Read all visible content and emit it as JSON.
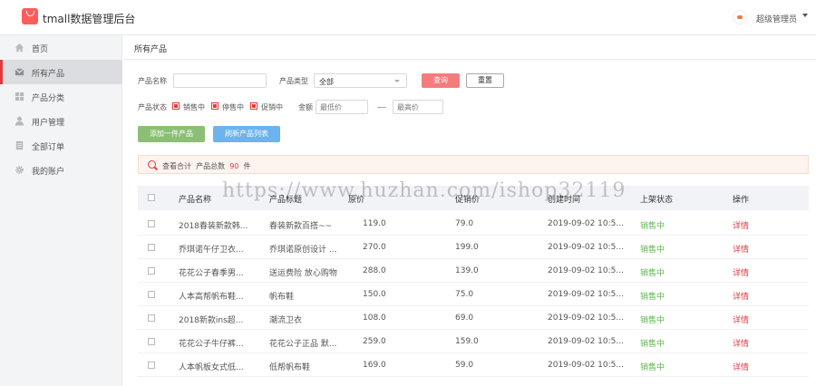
{
  "app": {
    "title": "tmall数据管理后台",
    "user_name": "超级管理员"
  },
  "sidebar": {
    "items": [
      {
        "label": "首页",
        "icon": "home-icon"
      },
      {
        "label": "所有产品",
        "icon": "mail-icon"
      },
      {
        "label": "产品分类",
        "icon": "grid-icon"
      },
      {
        "label": "用户管理",
        "icon": "user-icon"
      },
      {
        "label": "全部订单",
        "icon": "list-icon"
      },
      {
        "label": "我的账户",
        "icon": "gear-icon"
      }
    ],
    "active_index": 1
  },
  "breadcrumb": "所有产品",
  "filter": {
    "name_label": "产品名称",
    "name_value": "",
    "type_label": "产品类型",
    "type_value": "全部",
    "query_label": "查询",
    "reset_label": "重置",
    "status_label": "产品状态",
    "status_options": [
      "销售中",
      "停售中",
      "促销中"
    ],
    "amount_label": "金额",
    "min_placeholder": "最低价",
    "max_placeholder": "最高价"
  },
  "actions": {
    "add_label": "添加一件产品",
    "refresh_label": "刷新产品列表"
  },
  "summary": {
    "prefix": "查看合计",
    "total_label": "产品总数",
    "count": "90",
    "unit": "件"
  },
  "table": {
    "headers": [
      "产品名称",
      "产品标题",
      "原价",
      "促销价",
      "创建时间",
      "上架状态",
      "操作"
    ],
    "rows": [
      [
        "2018春装新款韩...",
        "春装新款百搭~~",
        "119.0",
        "79.0",
        "2019-09-02 10:5...",
        "销售中",
        "详情"
      ],
      [
        "乔琪诺午仔卫衣...",
        "乔琪诺原创设计 ...",
        "270.0",
        "199.0",
        "2019-09-02 10:5...",
        "销售中",
        "详情"
      ],
      [
        "花花公子春季男...",
        "送运费险 放心购物",
        "288.0",
        "139.0",
        "2019-09-02 10:5...",
        "销售中",
        "详情"
      ],
      [
        "人本高帮帆布鞋...",
        "帆布鞋",
        "150.0",
        "75.0",
        "2019-09-02 10:5...",
        "销售中",
        "详情"
      ],
      [
        "2018新款ins超...",
        "潮流卫衣",
        "108.0",
        "69.0",
        "2019-09-02 10:5...",
        "销售中",
        "详情"
      ],
      [
        "花花公子牛仔裤...",
        "花花公子正品 默...",
        "259.0",
        "159.0",
        "2019-09-02 10:5...",
        "销售中",
        "详情"
      ],
      [
        "人本帆板女式低...",
        "低帮帆布鞋",
        "169.0",
        "59.0",
        "2019-09-02 10:5...",
        "销售中",
        "详情"
      ]
    ]
  },
  "watermark": "https://www.huzhan.com/ishop32119"
}
